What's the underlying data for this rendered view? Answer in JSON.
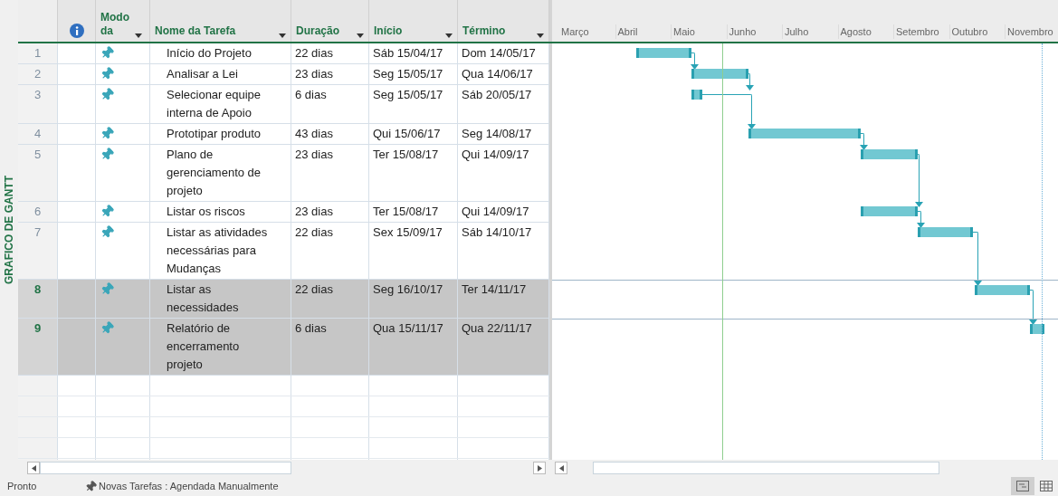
{
  "side_label": "GRAFICO DE GANTT",
  "columns": [
    {
      "label": "Modo da"
    },
    {
      "label": "Nome da Tarefa"
    },
    {
      "label": "Duração"
    },
    {
      "label": "Início"
    },
    {
      "label": "Término"
    }
  ],
  "months": [
    "Março",
    "Abril",
    "Maio",
    "Junho",
    "Julho",
    "Agosto",
    "Setembro",
    "Outubro",
    "Novembro"
  ],
  "tasks": [
    {
      "num": "1",
      "name": "Início do Projeto",
      "duration": "22 dias",
      "start": "Sáb 15/04/17",
      "end": "Dom 14/05/17",
      "selected": false
    },
    {
      "num": "2",
      "name": "Analisar a Lei",
      "duration": "23 dias",
      "start": "Seg 15/05/17",
      "end": "Qua 14/06/17",
      "selected": false
    },
    {
      "num": "3",
      "name": "Selecionar equipe interna de Apoio",
      "duration": "6 dias",
      "start": "Seg 15/05/17",
      "end": "Sáb 20/05/17",
      "selected": false
    },
    {
      "num": "4",
      "name": "Prototipar produto",
      "duration": "43 dias",
      "start": "Qui 15/06/17",
      "end": "Seg 14/08/17",
      "selected": false
    },
    {
      "num": "5",
      "name": "Plano de gerenciamento de projeto",
      "duration": "23 dias",
      "start": "Ter 15/08/17",
      "end": "Qui 14/09/17",
      "selected": false
    },
    {
      "num": "6",
      "name": "Listar os riscos",
      "duration": "23 dias",
      "start": "Ter 15/08/17",
      "end": "Qui 14/09/17",
      "selected": false
    },
    {
      "num": "7",
      "name": "Listar as atividades necessárias para Mudanças",
      "duration": "22 dias",
      "start": "Sex 15/09/17",
      "end": "Sáb 14/10/17",
      "selected": false
    },
    {
      "num": "8",
      "name": "Listar as necessidades",
      "duration": "22 dias",
      "start": "Seg 16/10/17",
      "end": "Ter 14/11/17",
      "selected": true
    },
    {
      "num": "9",
      "name": "Relatório de encerramento projeto",
      "duration": "6 dias",
      "start": "Qua 15/11/17",
      "end": "Qua 22/11/17",
      "selected": true
    }
  ],
  "status_bar": {
    "state": "Pronto",
    "new_tasks": "Novas Tarefas : Agendada Manualmente"
  }
}
